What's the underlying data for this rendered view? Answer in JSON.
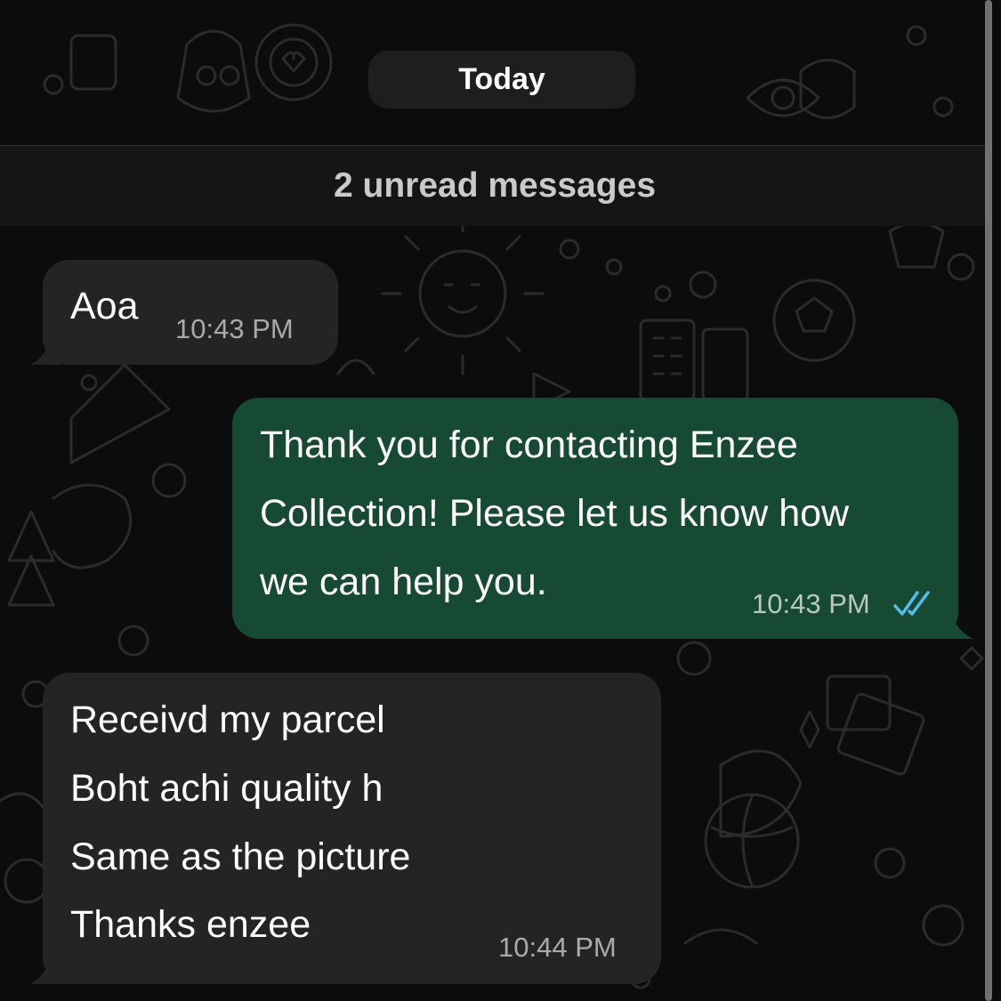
{
  "date_separator": "Today",
  "unread_banner": "2 unread messages",
  "colors": {
    "background": "#0c0c0c",
    "incoming_bubble": "#232525",
    "outgoing_bubble": "#164a32",
    "read_ticks": "#53bdeb"
  },
  "messages": [
    {
      "direction": "incoming",
      "text": "Aoa",
      "time": "10:43 PM"
    },
    {
      "direction": "outgoing",
      "lines": [
        "Thank you for contacting Enzee",
        "Collection! Please let us know how",
        "we can help you."
      ],
      "time": "10:43 PM",
      "status_icon": "double-check-read-icon"
    },
    {
      "direction": "incoming",
      "lines": [
        "Receivd my parcel",
        "Boht achi quality h",
        "Same as the picture",
        "Thanks enzee"
      ],
      "time": "10:44 PM"
    }
  ]
}
